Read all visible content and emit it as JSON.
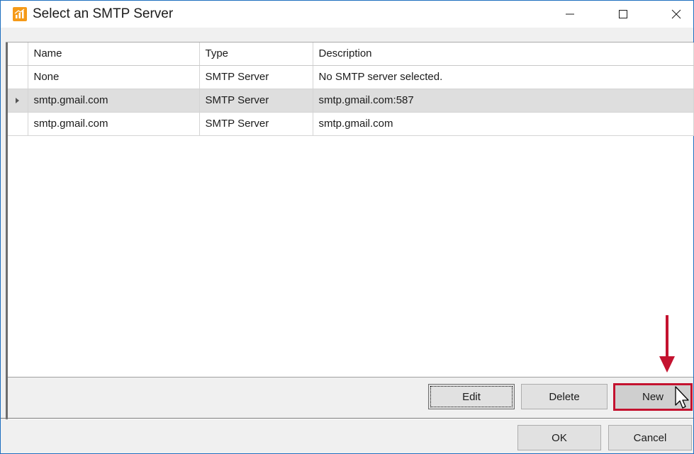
{
  "window": {
    "title": "Select an SMTP Server",
    "controls": [
      "minimize",
      "maximize",
      "close"
    ]
  },
  "grid": {
    "columns": [
      "Name",
      "Type",
      "Description"
    ],
    "rows": [
      {
        "name": "None",
        "type": "SMTP Server",
        "description": "No SMTP server selected.",
        "selected": false
      },
      {
        "name": "smtp.gmail.com",
        "type": "SMTP Server",
        "description": "smtp.gmail.com:587",
        "selected": true
      },
      {
        "name": "smtp.gmail.com",
        "type": "SMTP Server",
        "description": "smtp.gmail.com",
        "selected": false
      }
    ]
  },
  "actions": {
    "edit": "Edit",
    "delete": "Delete",
    "new": "New"
  },
  "dialog_buttons": {
    "ok": "OK",
    "cancel": "Cancel"
  },
  "colors": {
    "highlight": "#c4122f",
    "app_icon": "#f59a18",
    "selected_row": "#dedede"
  }
}
